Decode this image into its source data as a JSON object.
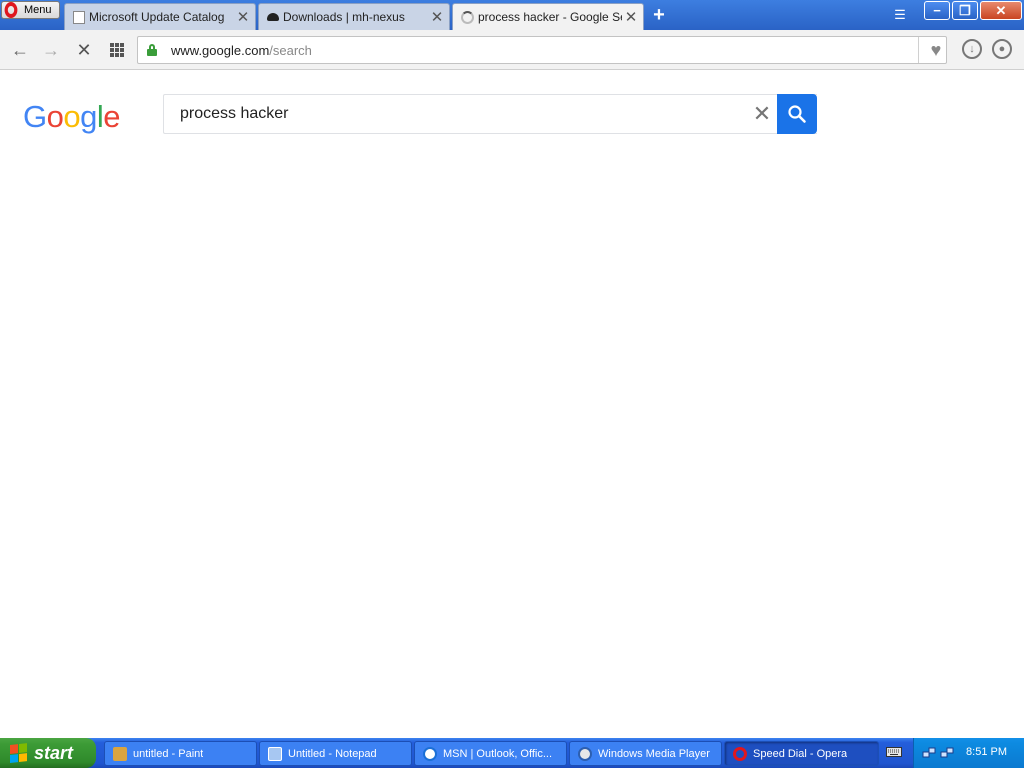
{
  "browser": {
    "menu_label": "Menu",
    "tabs": [
      {
        "label": "Microsoft Update Catalog"
      },
      {
        "label": "Downloads | mh-nexus"
      },
      {
        "label": "process hacker - Google Sear"
      }
    ],
    "address": {
      "domain": "www.google.com",
      "path": "/search"
    }
  },
  "google": {
    "logo_letters": [
      "G",
      "o",
      "o",
      "g",
      "l",
      "e"
    ],
    "logo_colors": [
      "#4285F4",
      "#EA4335",
      "#FBBC05",
      "#4285F4",
      "#34A853",
      "#EA4335"
    ],
    "query": "process hacker",
    "button_color": "#1a73e8"
  },
  "taskbar": {
    "start_label": "start",
    "items": [
      {
        "label": "untitled - Paint"
      },
      {
        "label": "Untitled - Notepad"
      },
      {
        "label": "MSN | Outlook, Offic..."
      },
      {
        "label": "Windows Media Player"
      },
      {
        "label": "Speed Dial - Opera"
      }
    ],
    "clock": "8:51 PM"
  }
}
